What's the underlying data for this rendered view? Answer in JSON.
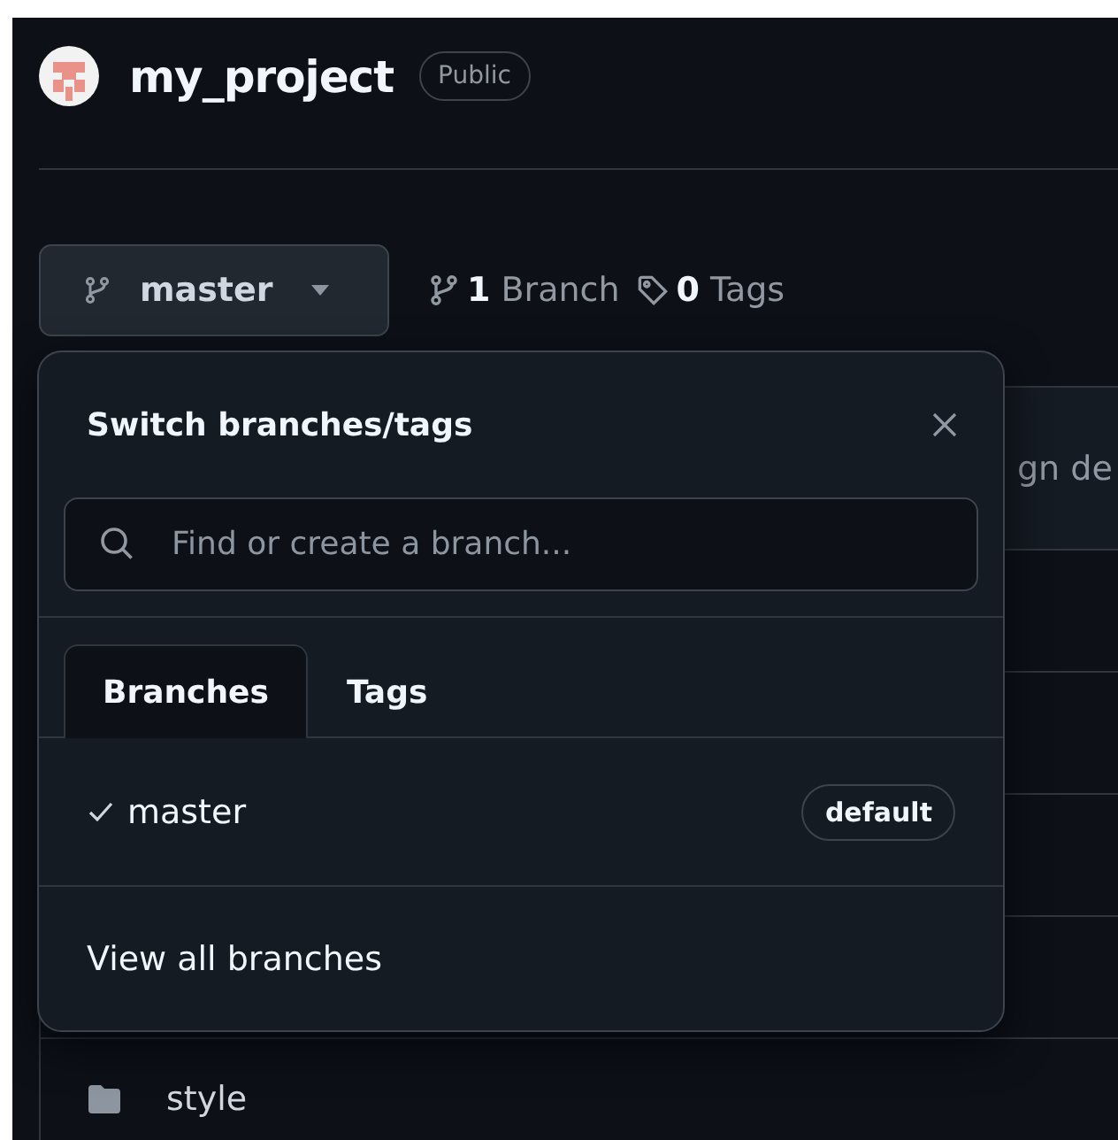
{
  "repo": {
    "name": "my_project",
    "visibility": "Public"
  },
  "branch_button": {
    "label": "master"
  },
  "counts": [
    {
      "kind": "branch",
      "count": "1",
      "label": "Branch"
    },
    {
      "kind": "tag",
      "count": "0",
      "label": "Tags"
    }
  ],
  "file_table": {
    "header_text": "gn de",
    "rows": [
      {
        "kind": "folder",
        "name": "style"
      }
    ]
  },
  "dropdown": {
    "title": "Switch branches/tags",
    "search": {
      "placeholder": "Find or create a branch..."
    },
    "tabs": [
      {
        "label": "Branches",
        "selected": true
      },
      {
        "label": "Tags",
        "selected": false
      }
    ],
    "branches": [
      {
        "name": "master",
        "selected": true,
        "badge": "default"
      }
    ],
    "footer_link": "View all branches"
  }
}
